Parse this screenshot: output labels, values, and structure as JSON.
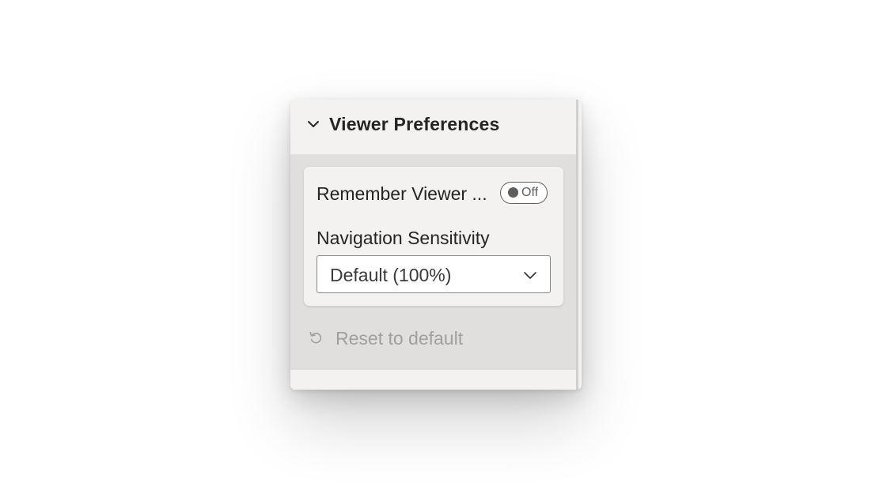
{
  "section": {
    "title": "Viewer Preferences",
    "expanded": true,
    "chevron_icon": "chevron-down-icon"
  },
  "remember_viewer": {
    "label": "Remember Viewer ...",
    "toggle_state": "Off"
  },
  "navigation_sensitivity": {
    "label": "Navigation Sensitivity",
    "selected": "Default (100%)",
    "caret_icon": "chevron-down-icon"
  },
  "reset": {
    "label": "Reset to default",
    "icon": "undo-icon",
    "disabled": true
  },
  "colors": {
    "panel_bg": "#f3f2f1",
    "body_bg": "#e1dfdd",
    "text": "#252423",
    "disabled_text": "#a19f9d",
    "toggle_border": "#605e5c"
  }
}
